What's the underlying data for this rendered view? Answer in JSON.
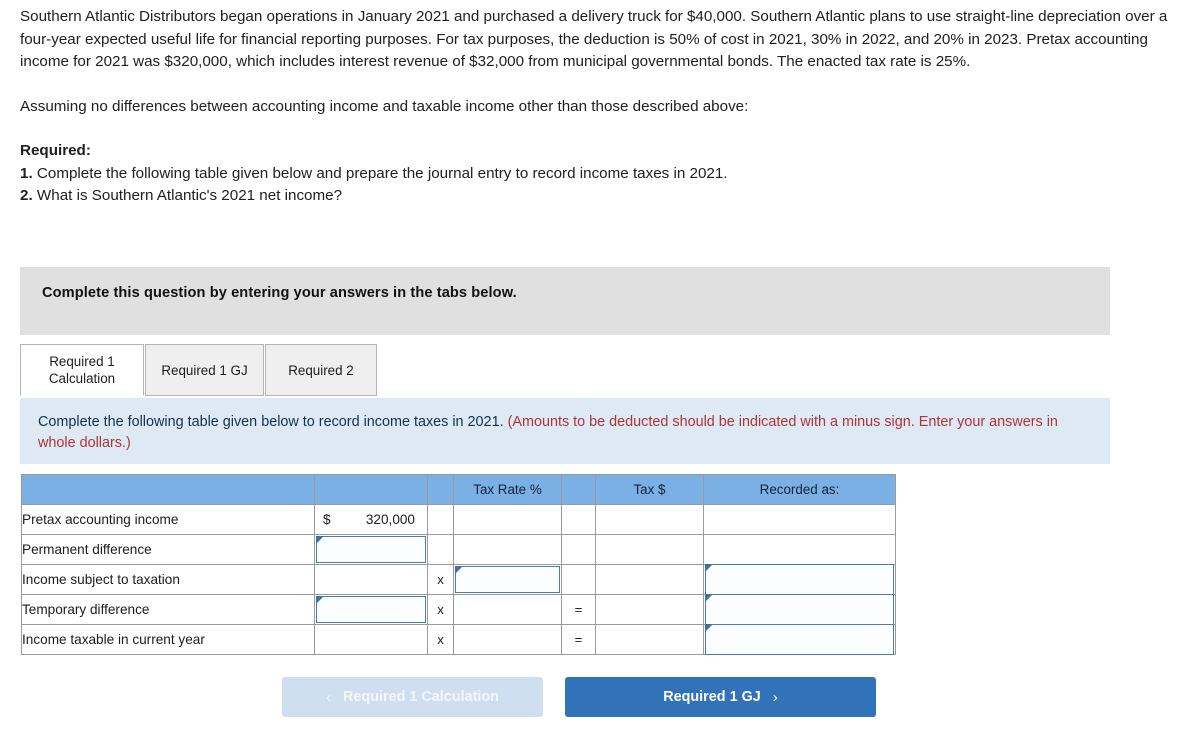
{
  "problem": {
    "paragraph": "Southern Atlantic Distributors began operations in January 2021 and purchased a delivery truck for $40,000. Southern Atlantic plans to use straight-line depreciation over a four-year expected useful life for financial reporting purposes. For tax purposes, the deduction is 50% of cost in 2021, 30% in 2022, and 20% in 2023. Pretax accounting income for 2021 was $320,000, which includes interest revenue of $32,000 from municipal governmental bonds. The enacted tax rate is 25%.",
    "assumption": "Assuming no differences between accounting income and taxable income other than those described above:",
    "required_heading": "Required:",
    "requirements": [
      {
        "num": "1.",
        "text": "Complete the following table given below and prepare the journal entry to record income taxes in 2021."
      },
      {
        "num": "2.",
        "text": "What is Southern Atlantic's 2021 net income?"
      }
    ]
  },
  "banner": {
    "text": "Complete this question by entering your answers in the tabs below."
  },
  "tabs": [
    {
      "label": "Required 1 Calculation",
      "active": true
    },
    {
      "label": "Required 1 GJ",
      "active": false
    },
    {
      "label": "Required 2",
      "active": false
    }
  ],
  "instruction": {
    "black_text": "Complete the following table given below to record income taxes in 2021. ",
    "red_text": "(Amounts to be deducted should be indicated with a minus sign. Enter your answers in whole dollars.)"
  },
  "table": {
    "headers": [
      "",
      "",
      "",
      "Tax Rate %",
      "",
      "Tax $",
      "Recorded as:"
    ],
    "rows": [
      {
        "label": "Pretax accounting income",
        "amount_symbol": "$",
        "amount_value": "320,000",
        "amount_input": false,
        "operator": "",
        "rate_input": false,
        "rate_value": "",
        "equals": "",
        "tax_value": "",
        "recorded_input": false
      },
      {
        "label": "Permanent difference",
        "amount_symbol": "",
        "amount_value": "",
        "amount_input": true,
        "operator": "",
        "rate_input": false,
        "rate_value": "",
        "equals": "",
        "tax_value": "",
        "recorded_input": false
      },
      {
        "label": "Income subject to taxation",
        "amount_symbol": "",
        "amount_value": "",
        "amount_input": false,
        "operator": "x",
        "rate_input": true,
        "rate_value": "",
        "equals": "",
        "tax_value": "",
        "recorded_input": true
      },
      {
        "label": "Temporary difference",
        "amount_symbol": "",
        "amount_value": "",
        "amount_input": true,
        "operator": "x",
        "rate_input": false,
        "rate_value": "",
        "equals": "=",
        "tax_value": "",
        "recorded_input": true
      },
      {
        "label": "Income taxable in current year",
        "amount_symbol": "",
        "amount_value": "",
        "amount_input": false,
        "operator": "x",
        "rate_input": false,
        "rate_value": "",
        "equals": "=",
        "tax_value": "",
        "recorded_input": true
      }
    ]
  },
  "nav": {
    "prev_label": "Required 1 Calculation",
    "next_label": "Required 1 GJ",
    "prev_chevron": "‹",
    "next_chevron": "›"
  },
  "colors": {
    "header_blue": "#7bb0e4",
    "panel_blue": "#ddeaf6",
    "banner_gray": "#e0e0e0",
    "accent_blue": "#3272b8",
    "red_note": "#b03434",
    "input_border": "#4a7cb0"
  }
}
